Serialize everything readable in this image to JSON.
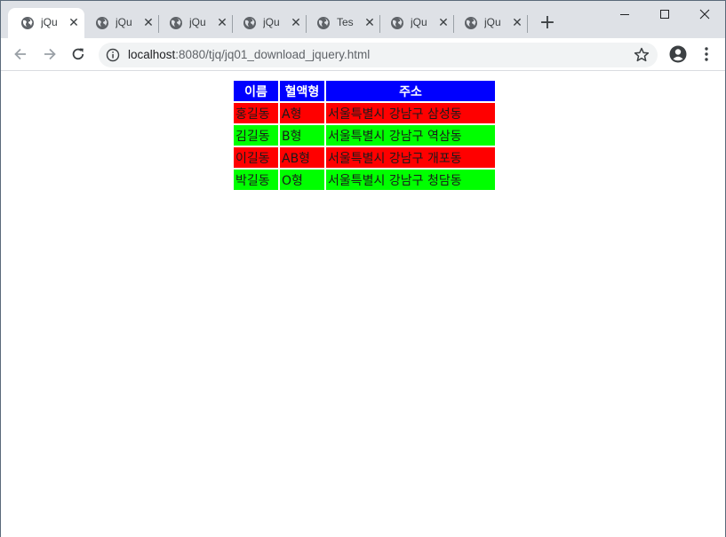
{
  "browser": {
    "tabs": [
      {
        "title": "jQu",
        "active": true
      },
      {
        "title": "jQu",
        "active": false
      },
      {
        "title": "jQu",
        "active": false
      },
      {
        "title": "jQu",
        "active": false
      },
      {
        "title": "Tes",
        "active": false
      },
      {
        "title": "jQu",
        "active": false
      },
      {
        "title": "jQu",
        "active": false
      }
    ],
    "tab_close_glyph": "✕",
    "new_tab_glyph": "+",
    "url_host": "localhost",
    "url_path": ":8080/tjq/jq01_download_jquery.html"
  },
  "table": {
    "headers": [
      "이름",
      "혈액형",
      "주소"
    ],
    "rows": [
      {
        "name": "홍길동",
        "blood": "A형",
        "address": "서울특별시 강남구 삼성동",
        "color": "#ff0000"
      },
      {
        "name": "김길동",
        "blood": "B형",
        "address": "서울특별시 강남구 역삼동",
        "color": "#00ff00"
      },
      {
        "name": "이길동",
        "blood": "AB형",
        "address": "서울특별시 강남구 개포동",
        "color": "#ff0000"
      },
      {
        "name": "박길동",
        "blood": "O형",
        "address": "서울특별시 강남구 청담동",
        "color": "#00ff00"
      }
    ],
    "header_color": "#0000ff"
  }
}
